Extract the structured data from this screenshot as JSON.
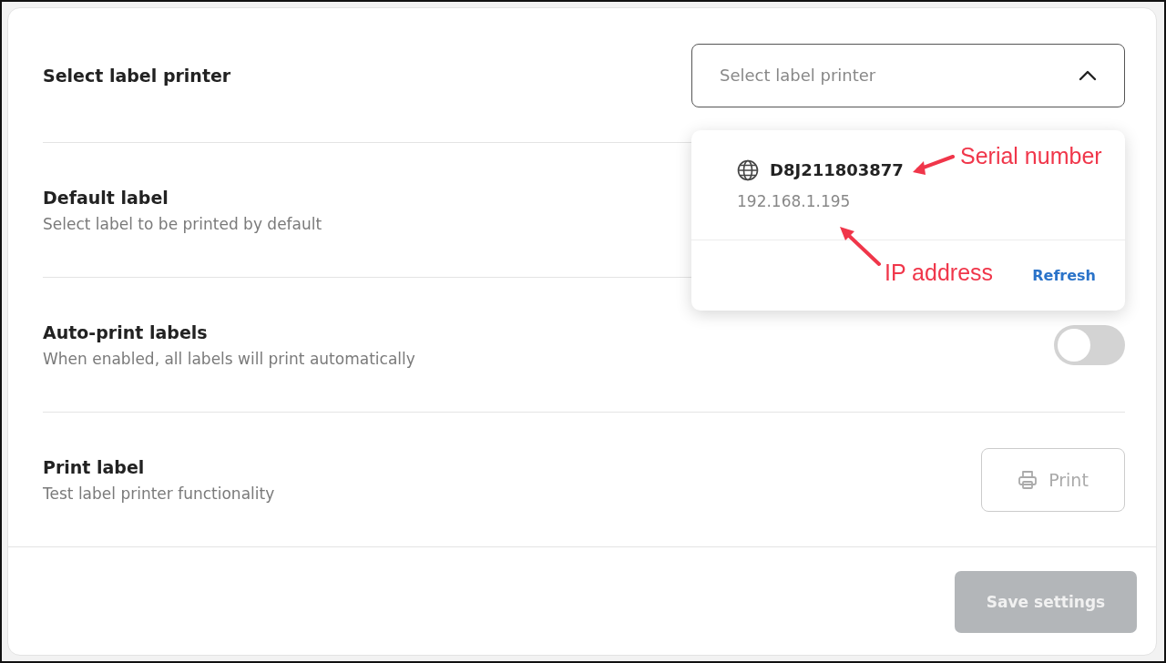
{
  "settings": [
    {
      "kind": "select",
      "title": "Select label printer",
      "select": {
        "placeholder": "Select label printer",
        "expanded": true
      }
    },
    {
      "kind": "plain",
      "title": "Default label",
      "description": "Select label to be printed by default"
    },
    {
      "kind": "toggle",
      "title": "Auto-print labels",
      "description": "When enabled, all labels will print automatically",
      "on": false
    },
    {
      "kind": "button",
      "title": "Print label",
      "description": "Test label printer functionality",
      "button": {
        "label": "Print",
        "disabled": true
      }
    }
  ],
  "dropdown": {
    "printers": [
      {
        "serial": "D8J211803877",
        "ip": "192.168.1.195"
      }
    ],
    "refresh": "Refresh"
  },
  "annotations": [
    {
      "text": "Serial number"
    },
    {
      "text": "IP address"
    }
  ],
  "save_button": {
    "label": "Save settings",
    "disabled": true
  }
}
